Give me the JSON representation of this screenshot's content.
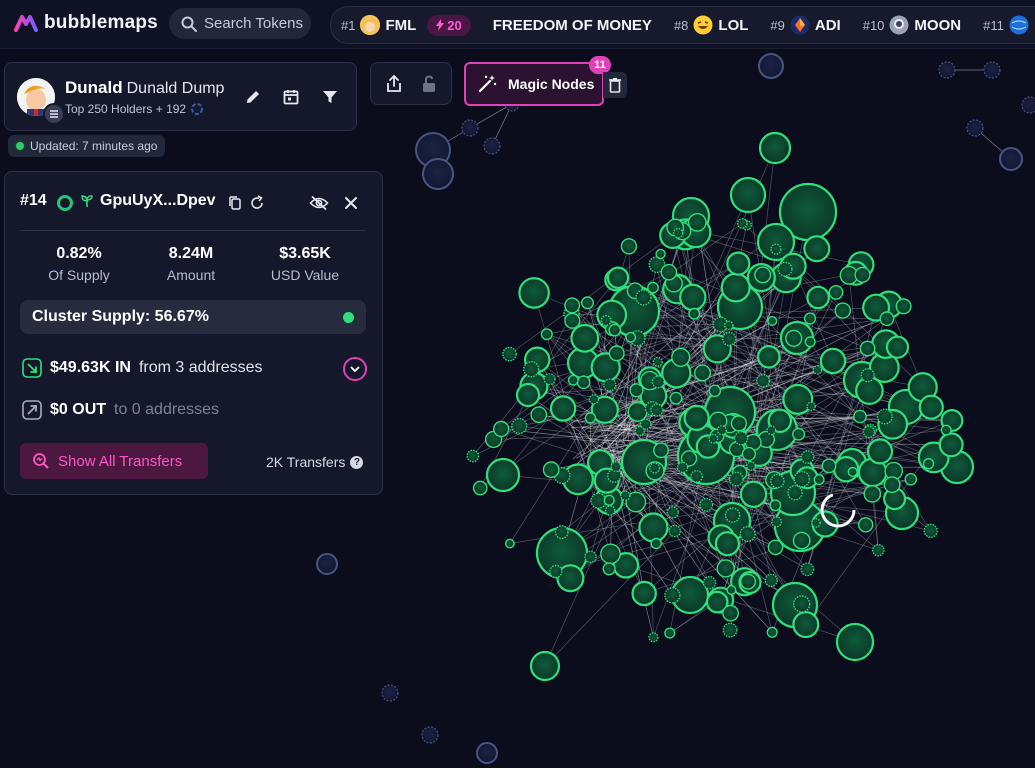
{
  "brand": {
    "name": "bubblemaps"
  },
  "search": {
    "placeholder": "Search Tokens"
  },
  "ticker": {
    "items": [
      {
        "rank": "#1",
        "name": "FML",
        "icon": "trump-avatar-icon",
        "badge": "20"
      },
      {
        "rank": "",
        "name": "FREEDOM OF MONEY",
        "icon": ""
      },
      {
        "rank": "#8",
        "name": "LOL",
        "icon": "laughing-face-icon"
      },
      {
        "rank": "#9",
        "name": "ADI",
        "icon": "diamond-icon"
      },
      {
        "rank": "#10",
        "name": "MOON",
        "icon": "astronaut-icon"
      },
      {
        "rank": "#11",
        "name": "",
        "icon": "globe-icon"
      }
    ]
  },
  "token": {
    "symbol": "Dunald",
    "name": "Dunald Dump",
    "subtitle": "Top 250 Holders + 192"
  },
  "status": {
    "updated": "Updated: 7 minutes ago"
  },
  "magic": {
    "label": "Magic Nodes",
    "count": "11"
  },
  "wallet": {
    "rank": "#14",
    "address": "GpuUyX...Dpev",
    "stats": [
      {
        "value": "0.82%",
        "label": "Of Supply"
      },
      {
        "value": "8.24M",
        "label": "Amount"
      },
      {
        "value": "$3.65K",
        "label": "USD Value"
      }
    ],
    "cluster": "Cluster Supply: 56.67%",
    "inflow": {
      "amount": "$49.63K IN",
      "detail": "from 3 addresses"
    },
    "outflow": {
      "amount": "$0 OUT",
      "detail": "to 0 addresses"
    },
    "show_all": "Show All Transfers",
    "transfers": "2K Transfers"
  },
  "colors": {
    "accent": "#e040b8",
    "node_green": "#2ee07c",
    "node_blue": "#3a4266",
    "background": "#0b0d1c"
  }
}
